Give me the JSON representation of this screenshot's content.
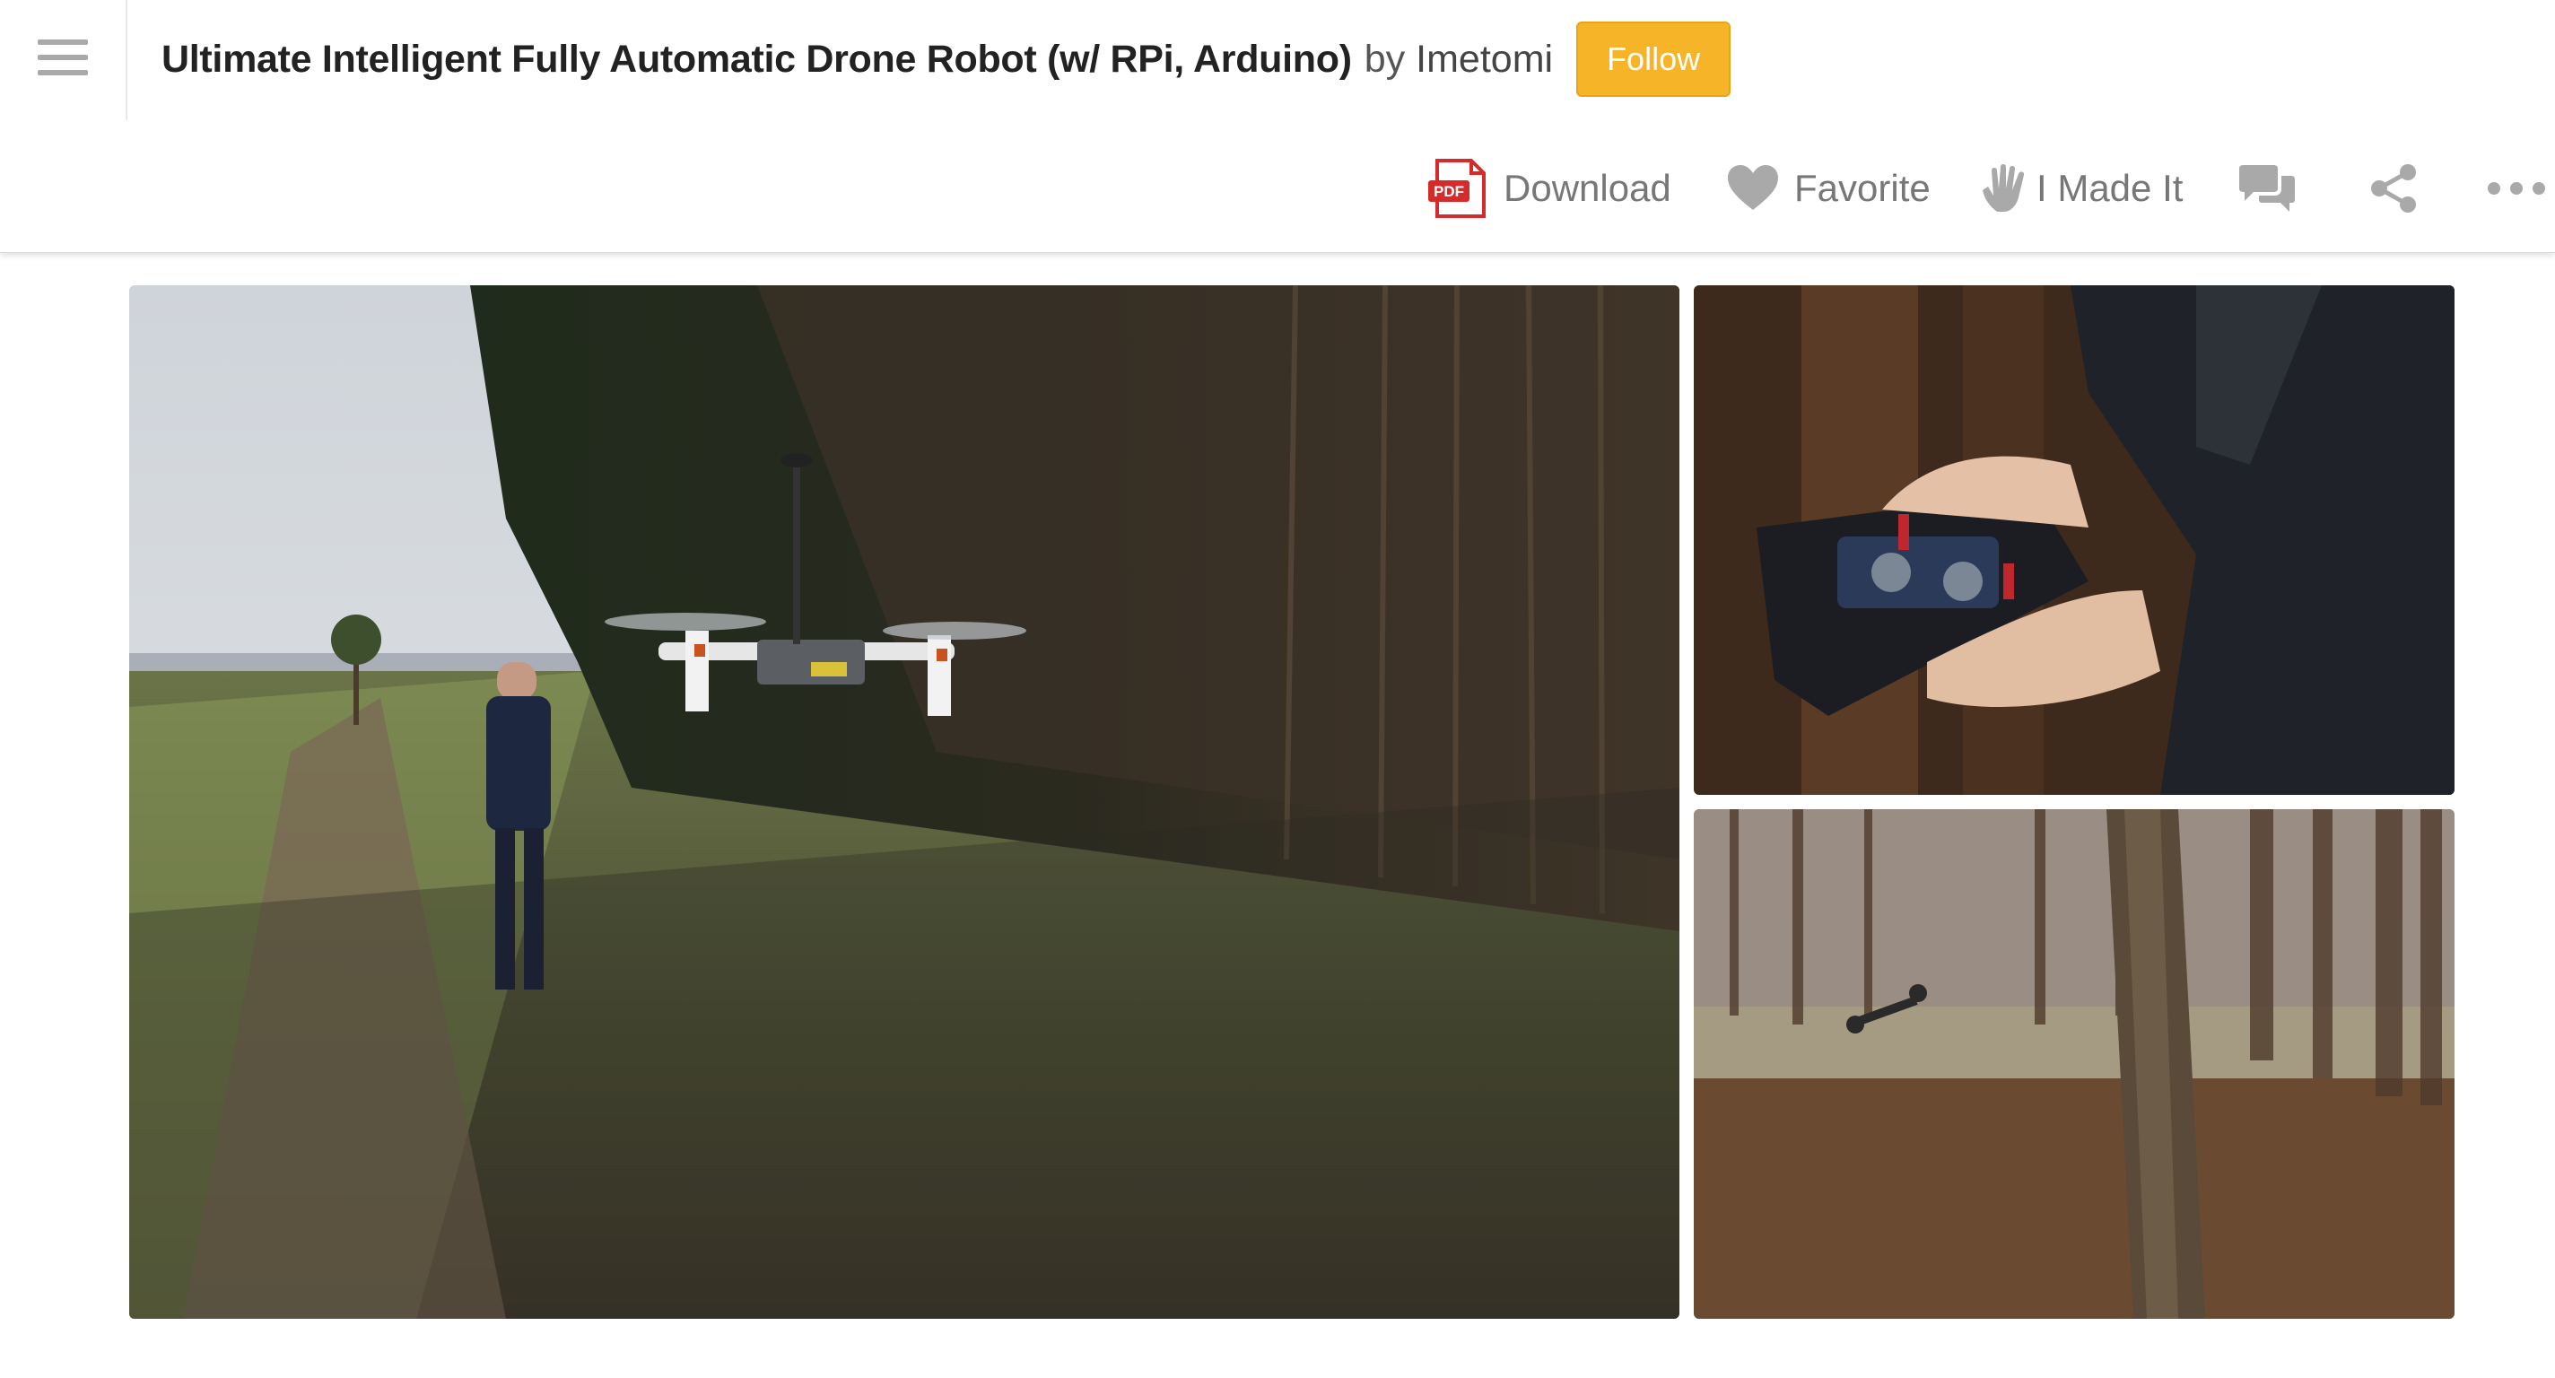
{
  "header": {
    "title": "Ultimate Intelligent Fully Automatic Drone Robot (w/ RPi, Arduino)",
    "byline": "by",
    "author": "Imetomi",
    "follow_label": "Follow"
  },
  "actions": {
    "download_label": "Download",
    "pdf_badge": "PDF",
    "favorite_label": "Favorite",
    "made_it_label": "I Made It"
  },
  "colors": {
    "follow_bg": "#f6b528",
    "pdf_red": "#d62b2b",
    "icon_gray": "#a9a9a9"
  },
  "icons": [
    "menu-icon",
    "pdf-icon",
    "heart-icon",
    "hand-icon",
    "comments-icon",
    "share-icon",
    "more-icon"
  ]
}
